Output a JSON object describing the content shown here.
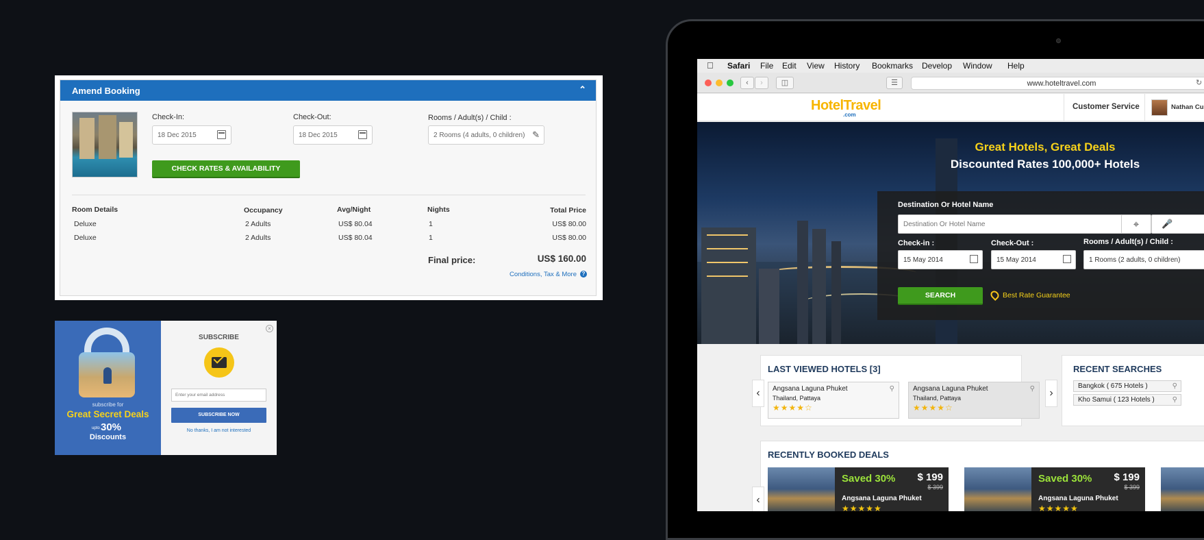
{
  "amend": {
    "title": "Amend Booking",
    "checkin_label": "Check-In:",
    "checkin_value": "18 Dec 2015",
    "checkout_label": "Check-Out:",
    "checkout_value": "18 Dec 2015",
    "rooms_label": "Rooms / Adult(s)  / Child :",
    "rooms_value": "2 Rooms (4 adults, 0 children)",
    "check_button": "CHECK RATES & AVAILABILITY",
    "headers": [
      "Room Details",
      "Occupancy",
      "Avg/Night",
      "Nights",
      "Total Price"
    ],
    "rows": [
      [
        "Deluxe",
        "2 Adults",
        "US$ 80.04",
        "1",
        "US$ 80.00"
      ],
      [
        "Deluxe",
        "2 Adults",
        "US$ 80.04",
        "1",
        "US$ 80.00"
      ]
    ],
    "final_label": "Final price:",
    "final_value": "US$ 160.00",
    "conditions_link": "Conditions, Tax & More"
  },
  "subscribe": {
    "title": "SUBSCRIBE",
    "email_placeholder": "Enter your email address",
    "button": "SUBSCRIBE NOW",
    "decline_link": "No thanks, I am not interested",
    "tag_small": "subscribe for",
    "tag_big": "Great Secret Deals",
    "upto": "upto",
    "percent": "30%",
    "discounts": "Discounts"
  },
  "browser": {
    "menu": [
      "Safari",
      "File",
      "Edit",
      "View",
      "History",
      "Bookmarks",
      "Develop",
      "Window",
      "Help"
    ],
    "url": "www.hoteltravel.com"
  },
  "site": {
    "logo_main": "HotelTravel",
    "logo_sub": ".com",
    "customer_service": "Customer Service",
    "user_name": "Nathan Curtis",
    "hero_line1": "Great Hotels, Great Deals",
    "hero_line2": "Discounted Rates 100,000+ Hotels",
    "dest_label": "Destination Or Hotel Name",
    "dest_placeholder": "Destination Or Hotel Name",
    "checkin_label": "Check-in :",
    "checkin_value": "15 May 2014",
    "checkout_label": "Check-Out :",
    "checkout_value": "15 May 2014",
    "rooms_label": "Rooms / Adult(s)  / Child :",
    "rooms_value": "1 Rooms (2 adults, 0 children)",
    "search_button": "SEARCH",
    "best_rate": "Best Rate Guarantee",
    "last_viewed_title": "LAST VIEWED HOTELS [3]",
    "last_viewed": [
      {
        "name": "Angsana Laguna Phuket",
        "location": "Thailand, Pattaya",
        "stars": "★★★★☆"
      },
      {
        "name": "Angsana Laguna Phuket",
        "location": "Thailand, Pattaya",
        "stars": "★★★★☆"
      }
    ],
    "recent_searches_title": "RECENT SEARCHES",
    "recent_searches": [
      "Bangkok ( 675 Hotels )",
      "Kho Samui ( 123 Hotels )"
    ],
    "recently_booked_title": "RECENTLY BOOKED DEALS",
    "deals": [
      {
        "saved": "Saved 30%",
        "price": "$ 199",
        "old_price": "$ 399",
        "name": "Angsana Laguna Phuket",
        "stars": "★★★★★"
      },
      {
        "saved": "Saved 30%",
        "price": "$ 199",
        "old_price": "$ 399",
        "name": "Angsana Laguna Phuket",
        "stars": "★★★★★"
      }
    ]
  },
  "colors": {
    "accent_blue": "#1e6fbd",
    "accent_green": "#3f9a1d",
    "hero_yellow": "#f7d21a",
    "title_navy": "#1f3a5c"
  }
}
